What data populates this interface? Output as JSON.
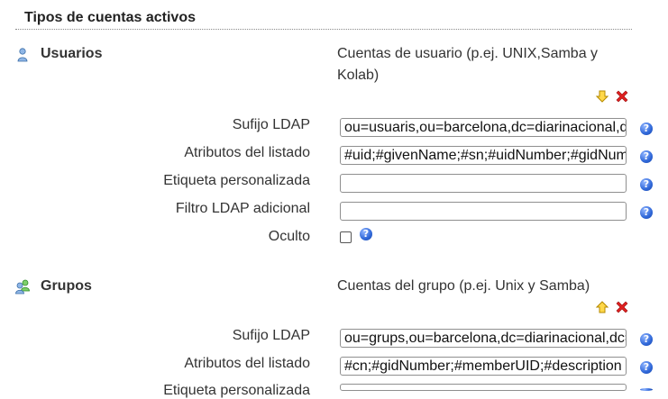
{
  "section": {
    "title": "Tipos de cuentas activos"
  },
  "types": [
    {
      "name": "Usuarios",
      "icon": "user-icon",
      "description": "Cuentas de usuario (p.ej. UNIX,Samba y Kolab)",
      "fields": {
        "suffix_label": "Sufijo LDAP",
        "suffix_value": "ou=usuaris,ou=barcelona,dc=diarinacional,dc=cat",
        "attrs_label": "Atributos del listado",
        "attrs_value": "#uid;#givenName;#sn;#uidNumber;#gidNumber",
        "custom_label": "Etiqueta personalizada",
        "custom_value": "",
        "filter_label": "Filtro LDAP adicional",
        "filter_value": "",
        "hidden_label": "Oculto"
      }
    },
    {
      "name": "Grupos",
      "icon": "group-icon",
      "description": "Cuentas del grupo (p.ej. Unix y Samba)",
      "fields": {
        "suffix_label": "Sufijo LDAP",
        "suffix_value": "ou=grups,ou=barcelona,dc=diarinacional,dc=cat",
        "attrs_label": "Atributos del listado",
        "attrs_value": "#cn;#gidNumber;#memberUID;#description",
        "custom_label": "Etiqueta personalizada",
        "custom_value": ""
      }
    }
  ],
  "icons": {
    "help": "help-icon",
    "move_down": "arrow-down-icon",
    "move_up": "arrow-up-icon",
    "delete": "delete-icon"
  },
  "colors": {
    "help_blue": "#2f67d8",
    "delete_red": "#e02020",
    "arrow_yellow": "#f0c020"
  }
}
